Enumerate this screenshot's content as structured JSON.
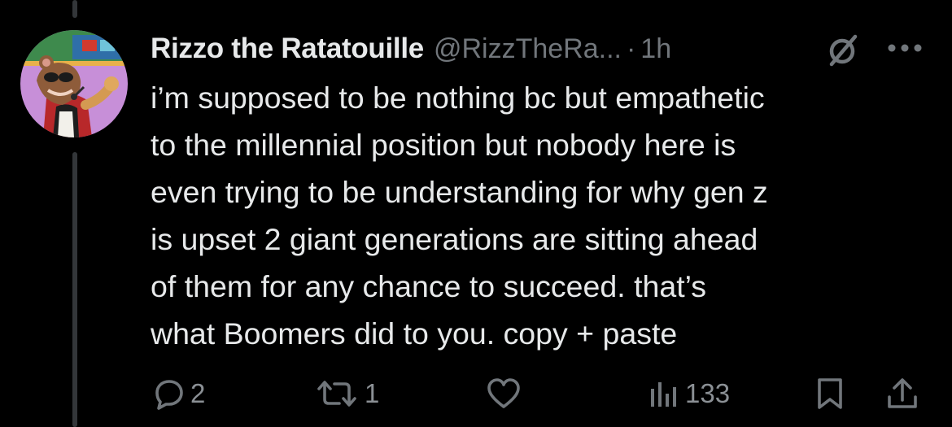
{
  "author": {
    "display_name": "Rizzo the Ratatouille",
    "handle": "@RizzTheRa...",
    "separator": "·",
    "time": "1h"
  },
  "tweet": {
    "lines": [
      "i’m supposed to be nothing bc but empathetic",
      "to the millennial position but nobody here is",
      "even trying to be understanding for why gen z",
      "is upset 2 giant generations are sitting ahead",
      "of them for any chance to succeed. that’s",
      "what Boomers did to you. copy + paste"
    ]
  },
  "actions": {
    "replies": "2",
    "retweets": "1",
    "views": "133"
  },
  "icons": {
    "header": [
      "grok-icon",
      "more-icon"
    ],
    "actions": [
      "reply-icon",
      "retweet-icon",
      "like-icon",
      "views-icon",
      "bookmark-icon",
      "share-icon"
    ]
  },
  "colors": {
    "background": "#000000",
    "text": "#e7e9ea",
    "muted": "#71767b",
    "thread_line": "#333639"
  }
}
